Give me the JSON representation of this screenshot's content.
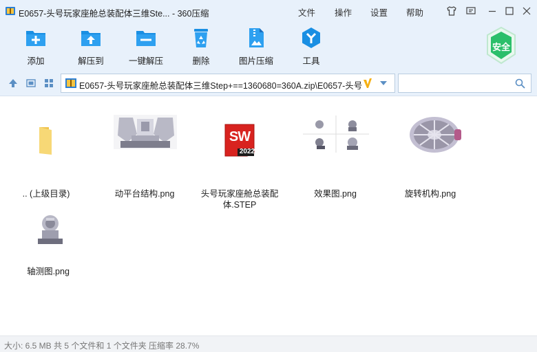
{
  "window": {
    "title": "E0657-头号玩家座舱总装配体三维Ste... - 360压缩"
  },
  "menu": {
    "file": "文件",
    "operate": "操作",
    "settings": "设置",
    "help": "帮助"
  },
  "toolbar": {
    "add": "添加",
    "extract_to": "解压到",
    "one_click_extract": "一键解压",
    "delete": "删除",
    "image_compress": "图片压缩",
    "tools": "工具"
  },
  "safety_badge": "安全",
  "address": {
    "path": "E0657-头号玩家座舱总装配体三维Step+==1360680=360A.zip\\E0657-头号"
  },
  "search": {
    "value": "",
    "placeholder": ""
  },
  "files": [
    {
      "name": ".. (上级目录)",
      "type": "folder"
    },
    {
      "name": "动平台结构.png",
      "type": "image"
    },
    {
      "name": "头号玩家座舱总装配体.STEP",
      "type": "solidworks",
      "badge_top": "SW",
      "badge_bottom": "2022"
    },
    {
      "name": "效果图.png",
      "type": "image"
    },
    {
      "name": "旋转机构.png",
      "type": "image"
    },
    {
      "name": "轴测图.png",
      "type": "image"
    }
  ],
  "status": {
    "text": "大小: 6.5 MB 共 5 个文件和 1 个文件夹 压缩率 28.7%"
  },
  "colors": {
    "chrome_bg": "#e8f1fb",
    "accent_blue": "#1a8fe3",
    "safe_green": "#2bbf6a"
  }
}
